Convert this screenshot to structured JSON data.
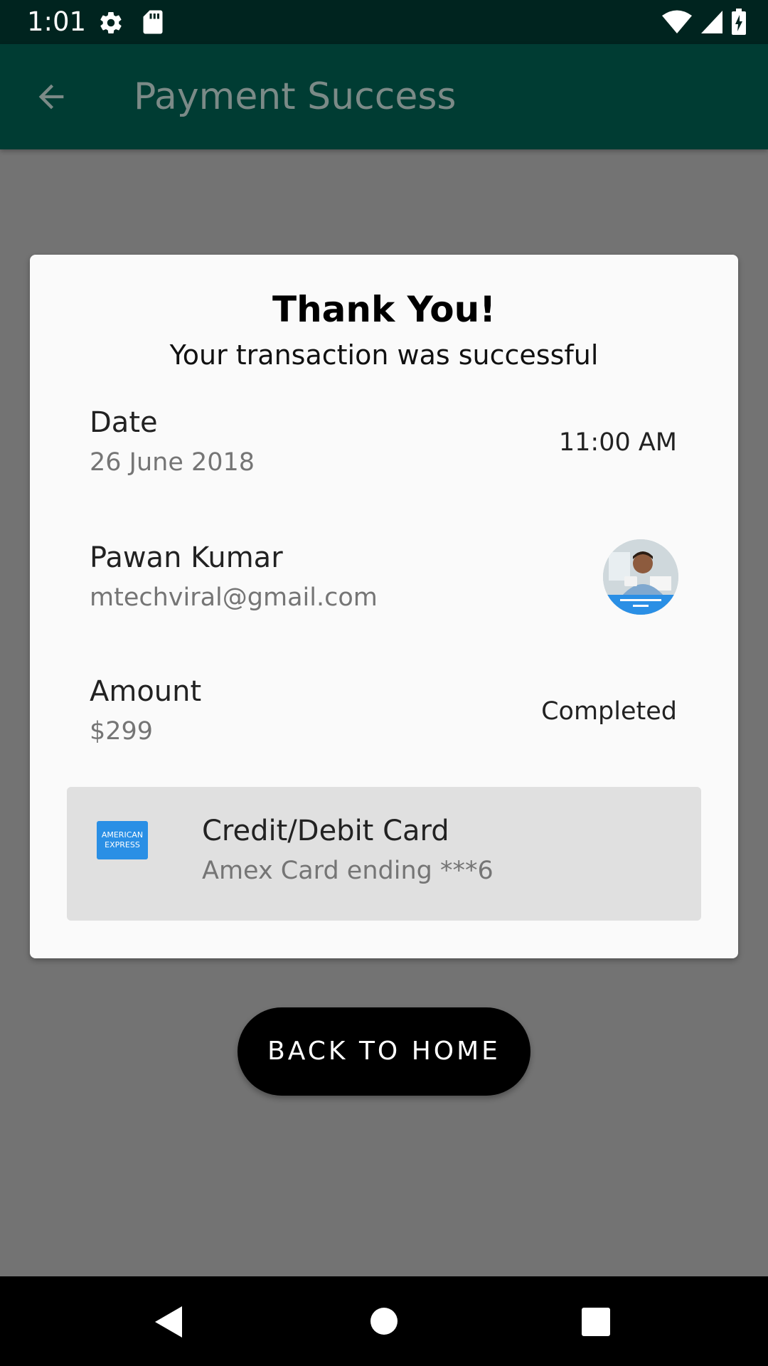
{
  "status_bar": {
    "time": "1:01"
  },
  "app_bar": {
    "title": "Payment Success"
  },
  "receipt": {
    "title": "Thank You!",
    "subtitle": "Your transaction was successful",
    "date_label": "Date",
    "date_value": "26 June 2018",
    "time_value": "11:00 AM",
    "name": "Pawan Kumar",
    "email": "mtechviral@gmail.com",
    "amount_label": "Amount",
    "amount_value": "$299",
    "status": "Completed",
    "payment_method": {
      "title": "Credit/Debit Card",
      "detail": "Amex Card ending ***6",
      "logo_line1": "AMERICAN",
      "logo_line2": "EXPRESS"
    }
  },
  "actions": {
    "back_home_label": "BACK TO HOME"
  },
  "colors": {
    "status_bar": "#00241f",
    "app_bar": "#003c33",
    "scrim": "#737373",
    "card": "#fafafa",
    "amex_blue": "#2a8fe5"
  },
  "icons": {
    "back": "arrow-left-icon",
    "settings": "gear-icon",
    "storage": "sd-card-icon",
    "wifi": "wifi-icon",
    "signal": "signal-icon",
    "battery": "battery-icon"
  }
}
